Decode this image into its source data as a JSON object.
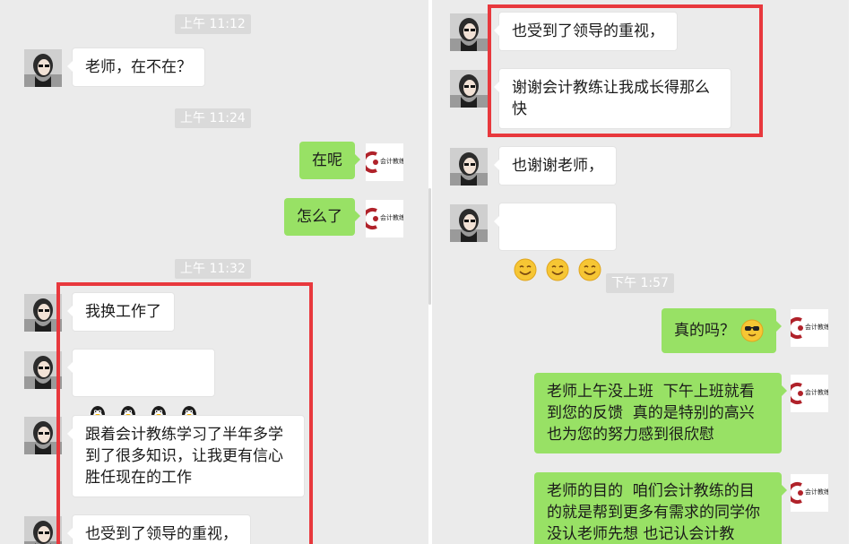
{
  "colors": {
    "chat_bg": "#ebebeb",
    "bubble_in": "#ffffff",
    "bubble_out": "#98e165",
    "highlight": "#e8383d",
    "timestamp_bg": "#dadada"
  },
  "left": {
    "time_1": "上午 11:12",
    "msg_1": "老师，在不在？",
    "time_2": "上午 11:24",
    "reply_1": "在呢",
    "reply_2": "怎么了",
    "time_3": "上午 11:32",
    "msg_2": "我换工作了",
    "msg_3_icons": [
      "qq-penguin-icon",
      "qq-penguin-icon",
      "qq-penguin-icon",
      "qq-penguin-icon"
    ],
    "msg_4": "跟着会计教练学习了半年多学到了很多知识，让我更有信心胜任现在的工作",
    "msg_5": "也受到了领导的重视，"
  },
  "right": {
    "msg_1": "也受到了领导的重视，",
    "msg_2": "谢谢会计教练让我成长得那么快",
    "msg_3": "也谢谢老师，",
    "msg_4_icons": [
      "smile-emoji-icon",
      "smile-emoji-icon",
      "smile-emoji-icon"
    ],
    "time_1": "下午 1:57",
    "reply_1": "真的吗？",
    "reply_1_icon": "cool-sunglasses-emoji-icon",
    "reply_2": "老师上午没上班  下午上班就看到您的反馈  真的是特别的高兴  也为您的努力感到很欣慰",
    "reply_3": "老师的目的  咱们会计教练的目的就是帮到更多有需求的同学你没认老师先想 也记认会计教"
  },
  "self_avatar_logo": "会计教练"
}
